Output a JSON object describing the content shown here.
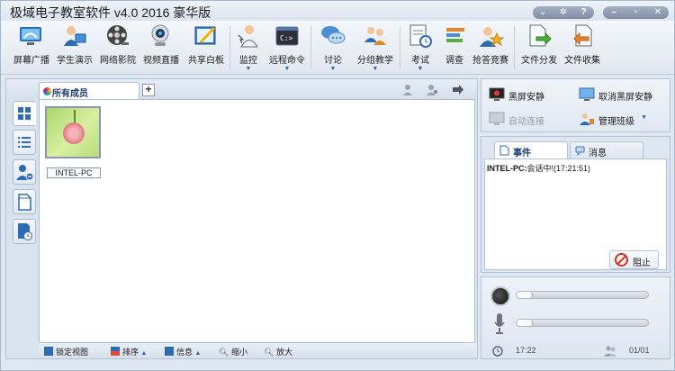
{
  "window": {
    "title": "极域电子教室软件 v4.0 2016 豪华版",
    "controls_left": [
      "chevron-down-icon",
      "gear-icon",
      "help-icon"
    ],
    "controls_right": [
      "minimize-icon",
      "restore-icon",
      "close-icon"
    ]
  },
  "toolbar": {
    "items": [
      {
        "label": "屏幕广播",
        "icon": "screen-broadcast-icon",
        "dropdown": false
      },
      {
        "label": "学生演示",
        "icon": "student-demo-icon",
        "dropdown": false
      },
      {
        "label": "网络影院",
        "icon": "film-reel-icon",
        "dropdown": false
      },
      {
        "label": "视频直播",
        "icon": "webcam-icon",
        "dropdown": false
      },
      {
        "label": "共享白板",
        "icon": "whiteboard-icon",
        "dropdown": false
      },
      {
        "label": "监控",
        "icon": "monitor-user-icon",
        "dropdown": true
      },
      {
        "label": "远程命令",
        "icon": "command-prompt-icon",
        "dropdown": true
      },
      {
        "label": "讨论",
        "icon": "chat-bubble-icon",
        "dropdown": true
      },
      {
        "label": "分组教学",
        "icon": "group-users-icon",
        "dropdown": true
      },
      {
        "label": "考试",
        "icon": "exam-clock-icon",
        "dropdown": true
      },
      {
        "label": "调查",
        "icon": "survey-bars-icon",
        "dropdown": false
      },
      {
        "label": "抢答竞赛",
        "icon": "star-user-icon",
        "dropdown": false
      },
      {
        "label": "文件分发",
        "icon": "file-send-icon",
        "dropdown": false
      },
      {
        "label": "文件收集",
        "icon": "file-collect-icon",
        "dropdown": false
      }
    ]
  },
  "members_panel": {
    "tab_label": "所有成员",
    "add_tab_icon": "plus-icon",
    "strip_icons": [
      "user-star-icon",
      "user-settings-icon",
      "arrow-right-icon"
    ],
    "side_tabs": [
      "thumbnail-view-icon",
      "list-view-icon",
      "user-remove-icon",
      "document-icon",
      "report-clock-icon"
    ],
    "members": [
      {
        "name": "INTEL-PC"
      }
    ],
    "bottom_bar": {
      "lock_view": "锁定视图",
      "sort": "排序",
      "info": "信息",
      "zoom_out": "缩小",
      "zoom_in": "放大"
    }
  },
  "controls": {
    "black_screen": "黑屏安静",
    "cancel_black_screen": "取消黑屏安静",
    "auto_connect": "自动连接",
    "manage_class": "管理班级"
  },
  "events": {
    "tab_events": "事件",
    "tab_messages": "消息",
    "log": [
      {
        "source": "INTEL-PC:",
        "text": "会话中!(17:21:51)"
      }
    ],
    "block_button": "阻止"
  },
  "audio": {
    "speaker_volume": 0.12,
    "mic_volume": 0.12,
    "time": "17:22",
    "online_count": "01/01"
  }
}
